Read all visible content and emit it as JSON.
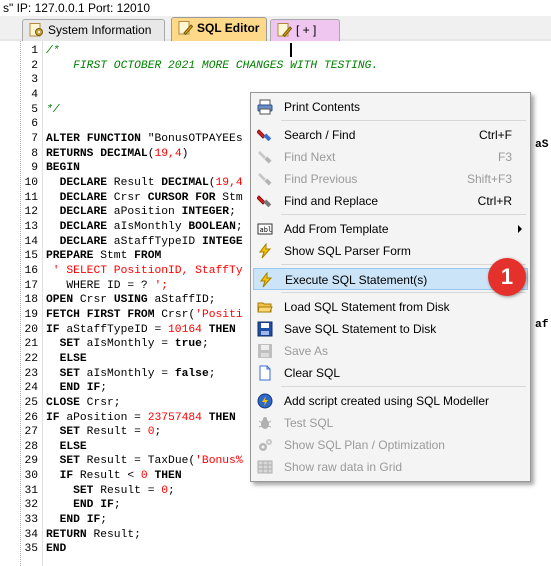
{
  "topbar": {
    "text": "s\" IP: 127.0.0.1 Port: 12010"
  },
  "tabs": [
    {
      "label": "System Information",
      "icon": "gear-document-icon"
    },
    {
      "label": "SQL Editor",
      "icon": "pencil-document-icon",
      "active": true
    },
    {
      "label": "[ + ]",
      "icon": "pencil-document-icon"
    }
  ],
  "editor": {
    "lines": [
      {
        "n": "1",
        "text": "/*"
      },
      {
        "n": "2",
        "text": "    FIRST OCTOBER 2021 MORE CHANGES WITH TESTING."
      },
      {
        "n": "3",
        "text": ""
      },
      {
        "n": "4",
        "text": ""
      },
      {
        "n": "5",
        "text": "*/"
      },
      {
        "n": "6",
        "text": ""
      },
      {
        "n": "7",
        "text": "ALTER FUNCTION \"BonusOTPAYEEs"
      },
      {
        "n": "8",
        "text": "RETURNS DECIMAL(19,4)"
      },
      {
        "n": "9",
        "text": "BEGIN"
      },
      {
        "n": "10",
        "text": "  DECLARE Result DECIMAL(19,4"
      },
      {
        "n": "11",
        "text": "  DECLARE Crsr CURSOR FOR Stm"
      },
      {
        "n": "12",
        "text": "  DECLARE aPosition INTEGER;"
      },
      {
        "n": "13",
        "text": "  DECLARE aIsMonthly BOOLEAN;"
      },
      {
        "n": "14",
        "text": "  DECLARE aStaffTypeID INTEGE"
      },
      {
        "n": "15",
        "text": "PREPARE Stmt FROM"
      },
      {
        "n": "16",
        "text": " ' SELECT PositionID, StaffTy"
      },
      {
        "n": "17",
        "text": "   WHERE ID = ? ';"
      },
      {
        "n": "18",
        "text": "OPEN Crsr USING aStaffID;"
      },
      {
        "n": "19",
        "text": "FETCH FIRST FROM Crsr('Positi"
      },
      {
        "n": "20",
        "text": "IF aStaffTypeID = 10164 THEN"
      },
      {
        "n": "21",
        "text": "  SET aIsMonthly = true;"
      },
      {
        "n": "22",
        "text": "  ELSE"
      },
      {
        "n": "23",
        "text": "  SET aIsMonthly = false;"
      },
      {
        "n": "24",
        "text": "  END IF;"
      },
      {
        "n": "25",
        "text": "CLOSE Crsr;"
      },
      {
        "n": "26",
        "text": "IF aPosition = 23757484 THEN"
      },
      {
        "n": "27",
        "text": "  SET Result = 0;"
      },
      {
        "n": "28",
        "text": "  ELSE"
      },
      {
        "n": "29",
        "text": "  SET Result = TaxDue('Bonus%"
      },
      {
        "n": "30",
        "text": "  IF Result < 0 THEN"
      },
      {
        "n": "31",
        "text": "    SET Result = 0;"
      },
      {
        "n": "32",
        "text": "    END IF;"
      },
      {
        "n": "33",
        "text": "  END IF;"
      },
      {
        "n": "34",
        "text": "RETURN Result;"
      },
      {
        "n": "35",
        "text": "END"
      }
    ],
    "overflow_right": [
      {
        "line": "7",
        "text": "aS"
      },
      {
        "line": "19",
        "text": "af"
      }
    ]
  },
  "context_menu": {
    "items": [
      {
        "label": "Print Contents",
        "icon": "printer-icon",
        "enabled": true
      },
      {
        "label": "Search / Find",
        "shortcut": "Ctrl+F",
        "icon": "search-flashlight-icon",
        "enabled": true
      },
      {
        "label": "Find Next",
        "shortcut": "F3",
        "icon": "find-next-icon",
        "enabled": false
      },
      {
        "label": "Find Previous",
        "shortcut": "Shift+F3",
        "icon": "find-previous-icon",
        "enabled": false
      },
      {
        "label": "Find and Replace",
        "shortcut": "Ctrl+R",
        "icon": "find-replace-icon",
        "enabled": true
      },
      {
        "label": "Add From Template",
        "icon": "template-icon",
        "enabled": true,
        "submenu": true
      },
      {
        "label": "Show SQL Parser Form",
        "icon": "lightning-icon",
        "enabled": true
      },
      {
        "label": "Execute SQL Statement(s)",
        "icon": "execute-lightning-icon",
        "enabled": true,
        "highlighted": true
      },
      {
        "label": "Load SQL Statement from Disk",
        "icon": "open-folder-icon",
        "enabled": true
      },
      {
        "label": "Save SQL Statement to Disk",
        "icon": "floppy-disk-icon",
        "enabled": true
      },
      {
        "label": "Save As",
        "icon": "save-as-icon",
        "enabled": false
      },
      {
        "label": "Clear SQL",
        "icon": "blank-page-icon",
        "enabled": true
      },
      {
        "label": "Add script created using SQL Modeller",
        "icon": "modeller-icon",
        "enabled": true
      },
      {
        "label": "Test SQL",
        "icon": "bug-icon",
        "enabled": false
      },
      {
        "label": "Show SQL Plan / Optimization",
        "icon": "gears-icon",
        "enabled": false
      },
      {
        "label": "Show raw data in Grid",
        "icon": "grid-icon",
        "enabled": false
      }
    ]
  },
  "badge": {
    "text": "1",
    "color": "#e5312b"
  }
}
